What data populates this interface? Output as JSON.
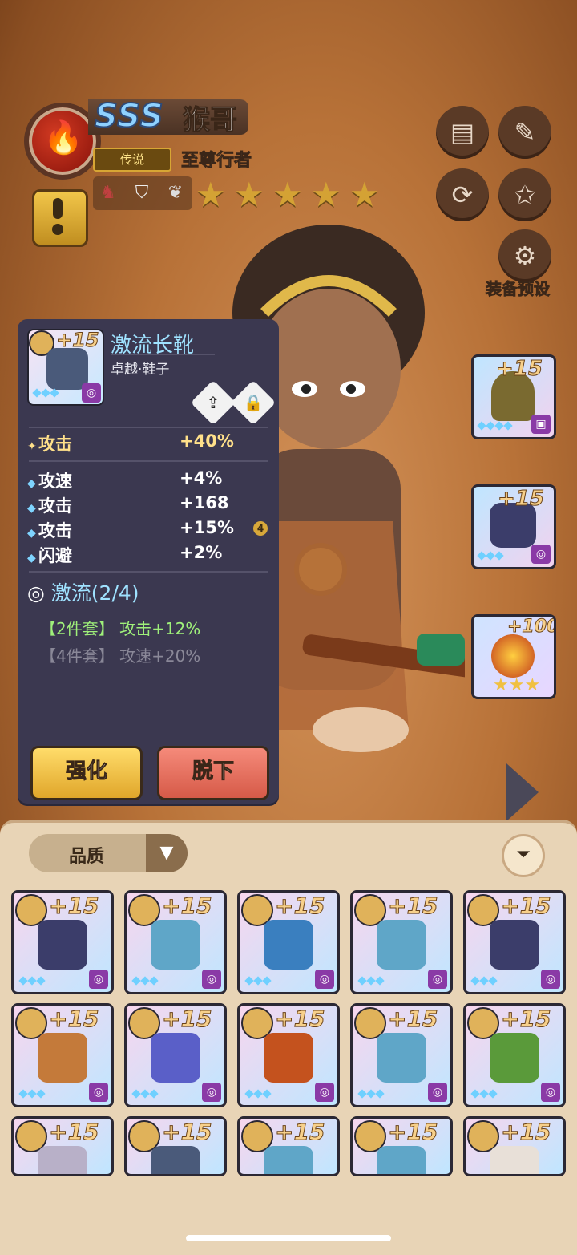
{
  "hero": {
    "grade": "SSS",
    "name": "猴哥",
    "rarity": "传说",
    "title": "至尊行者",
    "stars": 5,
    "role_icons": [
      "mask-icon",
      "armor-icon",
      "leaf-icon"
    ]
  },
  "right_menu": {
    "preset_label": "装备预设"
  },
  "item_panel": {
    "enhance": "+15",
    "name": "激流长靴",
    "type": "卓越·鞋子",
    "main_stat": {
      "name": "攻击",
      "value": "+40%"
    },
    "sub_stats": [
      {
        "name": "攻速",
        "value": "+4%"
      },
      {
        "name": "攻击",
        "value": "+168"
      },
      {
        "name": "攻击",
        "value": "+15%",
        "badge": "4"
      },
      {
        "name": "闪避",
        "value": "+2%"
      }
    ],
    "set_name": "激流(2/4)",
    "set_bonus_2": "【2件套】 攻击+12%",
    "set_bonus_4": "【4件套】 攻速+20%",
    "enhance_button": "强化",
    "unequip_button": "脱下"
  },
  "equipped_slots": [
    {
      "enhance": "+15",
      "kind": "helmet"
    },
    {
      "enhance": "+15",
      "kind": "boots"
    },
    {
      "enhance": "+100",
      "kind": "accessory"
    }
  ],
  "inventory": {
    "sort_label": "品质",
    "items": [
      {
        "enhance": "+15",
        "color": "#3b3d6a"
      },
      {
        "enhance": "+15",
        "color": "#5fa6c8"
      },
      {
        "enhance": "+15",
        "color": "#3a7fbf"
      },
      {
        "enhance": "+15",
        "color": "#5fa6c8"
      },
      {
        "enhance": "+15",
        "color": "#3b3d6a"
      },
      {
        "enhance": "+15",
        "color": "#c47a3a"
      },
      {
        "enhance": "+15",
        "color": "#5a5fc8"
      },
      {
        "enhance": "+15",
        "color": "#c4521e"
      },
      {
        "enhance": "+15",
        "color": "#5fa6c8"
      },
      {
        "enhance": "+15",
        "color": "#5a9a3a"
      },
      {
        "enhance": "+15",
        "color": "#b8b0c8"
      },
      {
        "enhance": "+15",
        "color": "#4a5a7a"
      },
      {
        "enhance": "+15",
        "color": "#5fa6c8"
      },
      {
        "enhance": "+15",
        "color": "#5fa6c8"
      },
      {
        "enhance": "+15",
        "color": "#e8e0d8"
      }
    ]
  }
}
